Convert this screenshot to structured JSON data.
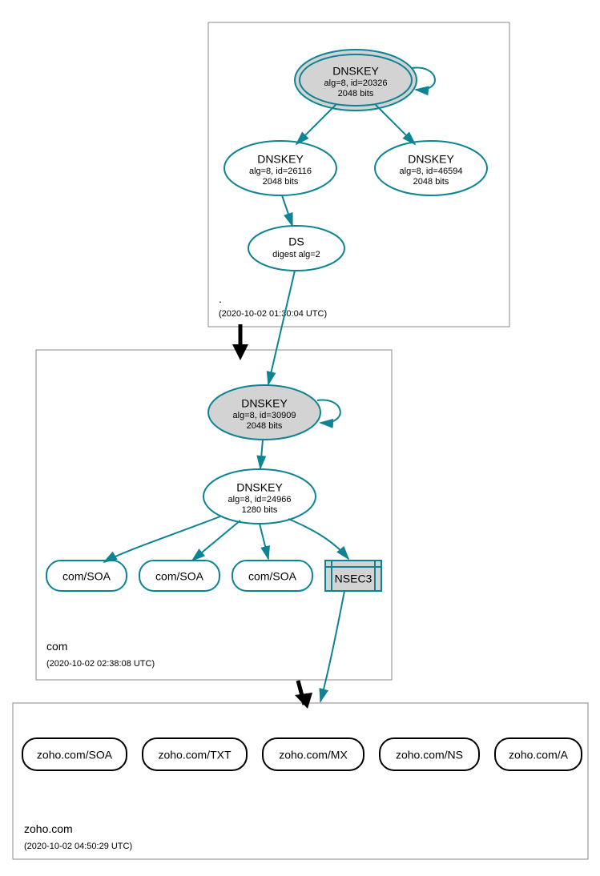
{
  "zones": {
    "root": {
      "label": ".",
      "timestamp": "(2020-10-02 01:30:04 UTC)"
    },
    "com": {
      "label": "com",
      "timestamp": "(2020-10-02 02:38:08 UTC)"
    },
    "zoho": {
      "label": "zoho.com",
      "timestamp": "(2020-10-02 04:50:29 UTC)"
    }
  },
  "nodes": {
    "rootKSK": {
      "title": "DNSKEY",
      "line2": "alg=8, id=20326",
      "line3": "2048 bits"
    },
    "rootZSK1": {
      "title": "DNSKEY",
      "line2": "alg=8, id=26116",
      "line3": "2048 bits"
    },
    "rootZSK2": {
      "title": "DNSKEY",
      "line2": "alg=8, id=46594",
      "line3": "2048 bits"
    },
    "ds": {
      "title": "DS",
      "line2": "digest alg=2"
    },
    "comKSK": {
      "title": "DNSKEY",
      "line2": "alg=8, id=30909",
      "line3": "2048 bits"
    },
    "comZSK": {
      "title": "DNSKEY",
      "line2": "alg=8, id=24966",
      "line3": "1280 bits"
    },
    "comSOA1": "com/SOA",
    "comSOA2": "com/SOA",
    "comSOA3": "com/SOA",
    "nsec3": "NSEC3",
    "zohoSOA": "zoho.com/SOA",
    "zohoTXT": "zoho.com/TXT",
    "zohoMX": "zoho.com/MX",
    "zohoNS": "zoho.com/NS",
    "zohoA": "zoho.com/A"
  }
}
